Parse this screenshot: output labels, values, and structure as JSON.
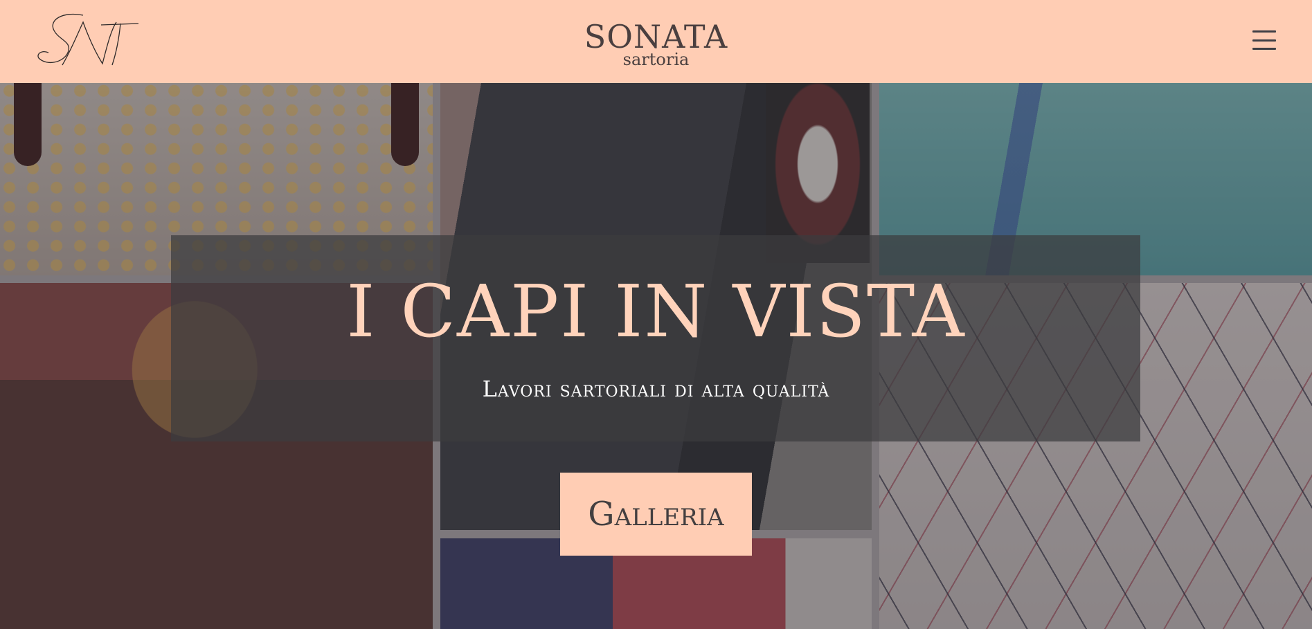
{
  "header": {
    "logo_text": "SNT",
    "brand_name": "SONATA",
    "brand_sub": "sartoria",
    "menu_icon": "hamburger-menu-icon"
  },
  "hero": {
    "title": "I CAPI IN VISTA",
    "subtitle": "Lavori sartoriali di alta qualità",
    "cta_label": "Galleria"
  },
  "colors": {
    "header_bg": "#ffcdb4",
    "title": "#ffd3bb",
    "brand_text": "#4a3f3f",
    "caption_overlay": "#3c3c3e"
  }
}
